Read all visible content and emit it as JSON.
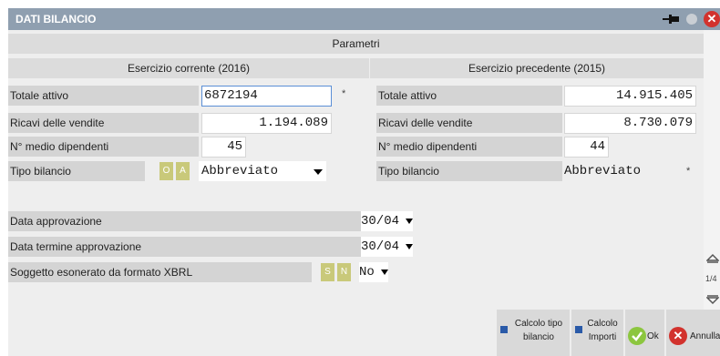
{
  "window": {
    "title": "DATI BILANCIO"
  },
  "section_title": "Parametri",
  "current": {
    "header": "Esercizio corrente (2016)",
    "totale_attivo_label": "Totale attivo",
    "totale_attivo_value": "6872194",
    "ricavi_label": "Ricavi delle vendite",
    "ricavi_value": "1.194.089",
    "dipendenti_label": "N° medio dipendenti",
    "dipendenti_value": "45",
    "tipo_label": "Tipo bilancio",
    "tipo_opt_o": "O",
    "tipo_opt_a": "A",
    "tipo_value": "Abbreviato",
    "required_mark": "*"
  },
  "previous": {
    "header": "Esercizio precedente (2015)",
    "totale_attivo_label": "Totale attivo",
    "totale_attivo_value": "14.915.405",
    "ricavi_label": "Ricavi delle vendite",
    "ricavi_value": "8.730.079",
    "dipendenti_label": "N° medio dipendenti",
    "dipendenti_value": "44",
    "tipo_label": "Tipo bilancio",
    "tipo_value": "Abbreviato",
    "required_mark": "*"
  },
  "dates": {
    "approvazione_label": "Data approvazione",
    "approvazione_value": "30/04",
    "termine_label": "Data termine approvazione",
    "termine_value": "30/04",
    "xbrl_label": "Soggetto esonerato da formato XBRL",
    "xbrl_opt_s": "S",
    "xbrl_opt_n": "N",
    "xbrl_value": "No"
  },
  "scrollbar": {
    "page": "1/4"
  },
  "buttons": {
    "calcolo_tipo_line1": "Calcolo tipo",
    "calcolo_tipo_line2": "bilancio",
    "calcolo_importi_line1": "Calcolo",
    "calcolo_importi_line2": "Importi",
    "ok": "Ok",
    "annulla": "Annulla"
  },
  "colors": {
    "title_bar": "#8f9fb0",
    "accent_blue": "#2a5aa8",
    "ok_green": "#8cc63f",
    "close_red": "#d2322d",
    "toggle": "#c9c97a"
  }
}
